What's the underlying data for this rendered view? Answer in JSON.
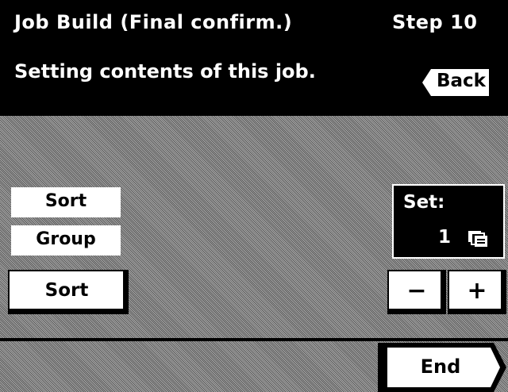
{
  "header": {
    "title": "Job Build (Final confirm.)",
    "step": "Step 10"
  },
  "message": "Setting contents of this job.",
  "back_button": {
    "label": "Back"
  },
  "main": {
    "sort_tag": "Sort",
    "group_tag": "Group",
    "sort_button": "Sort",
    "set": {
      "label": "Set:",
      "value": "1",
      "icon": "copies-stack-icon"
    },
    "minus_button": "−",
    "plus_button": "+"
  },
  "footer": {
    "end_button": "End"
  },
  "colors": {
    "bar": "#000000",
    "panel_gray": "#8c8c8c",
    "button": "#ffffff"
  }
}
